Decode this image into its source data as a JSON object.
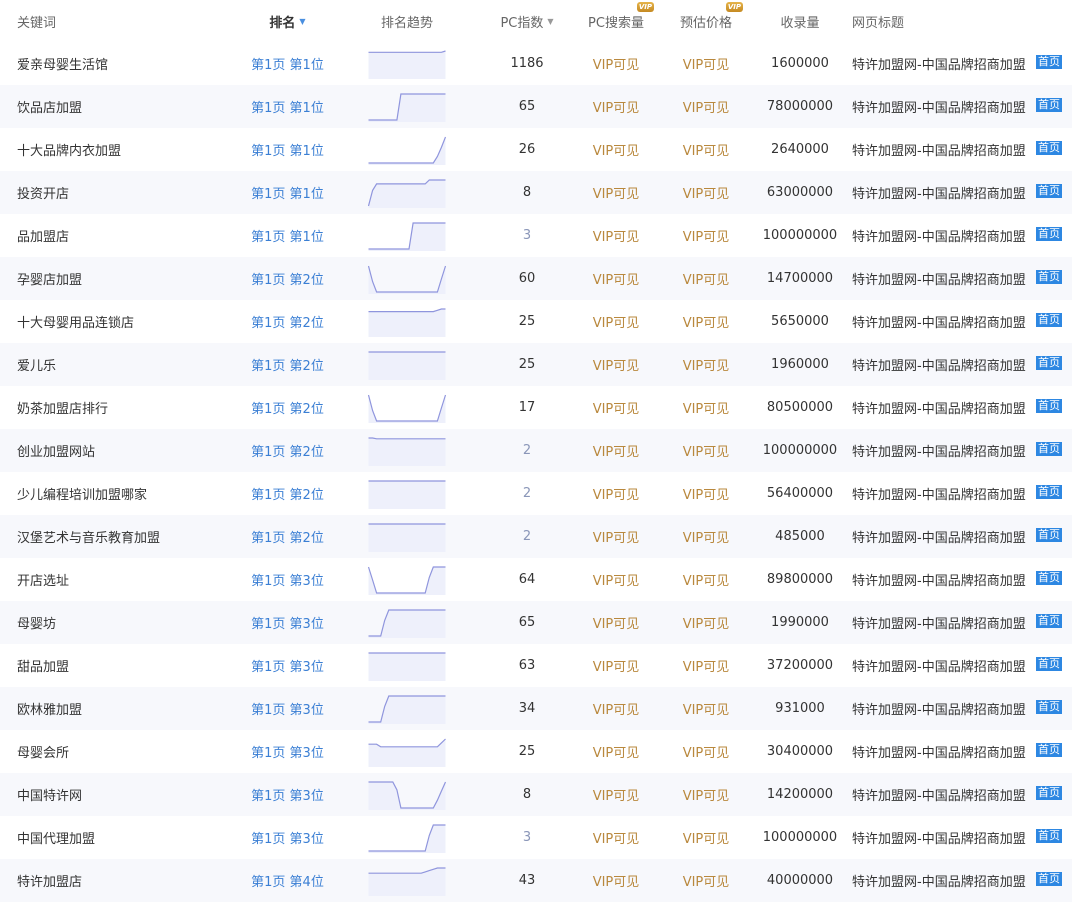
{
  "header": {
    "keyword": "关键词",
    "rank": "排名",
    "trend": "排名趋势",
    "pc_index": "PC指数",
    "pc_search": "PC搜索量",
    "est_price": "预估价格",
    "record_count": "收录量",
    "page_title": "网页标题",
    "vip_badge": "VIP",
    "sort_desc_icon": "▼"
  },
  "colors": {
    "rank_link": "#3b7fd4",
    "vip_text": "#b9883d",
    "home_tag": "#2d87e2",
    "trend_line": "#8f95dd",
    "trend_fill": "#eef0fb"
  },
  "rows": [
    {
      "keyword": "爱亲母婴生活馆",
      "rank": "第1页 第1位",
      "pc_index": "1186",
      "pc_index_light": false,
      "pc_search": "VIP可见",
      "est_price": "VIP可见",
      "record_count": "1600000",
      "page_title": "特许加盟网-中国品牌招商加盟",
      "tag": "首页",
      "trend": [
        0.05,
        0.05,
        0.05,
        0.05,
        0.05,
        0.05,
        0.05,
        0.05,
        0.05,
        0.05,
        0.05,
        0.05,
        0.05,
        0.05,
        0.05,
        0.05,
        0.05,
        0.05,
        0.05,
        0
      ]
    },
    {
      "keyword": "饮品店加盟",
      "rank": "第1页 第1位",
      "pc_index": "65",
      "pc_index_light": false,
      "pc_search": "VIP可见",
      "est_price": "VIP可见",
      "record_count": "78000000",
      "page_title": "特许加盟网-中国品牌招商加盟",
      "tag": "首页",
      "trend": [
        1,
        1,
        1,
        1,
        1,
        1,
        1,
        1,
        0,
        0,
        0,
        0,
        0,
        0,
        0,
        0,
        0,
        0,
        0,
        0
      ]
    },
    {
      "keyword": "十大品牌内衣加盟",
      "rank": "第1页 第1位",
      "pc_index": "26",
      "pc_index_light": false,
      "pc_search": "VIP可见",
      "est_price": "VIP可见",
      "record_count": "2640000",
      "page_title": "特许加盟网-中国品牌招商加盟",
      "tag": "首页",
      "trend": [
        1,
        1,
        1,
        1,
        1,
        1,
        1,
        1,
        1,
        1,
        1,
        1,
        1,
        1,
        1,
        1,
        1,
        0.75,
        0.4,
        0
      ]
    },
    {
      "keyword": "投资开店",
      "rank": "第1页 第1位",
      "pc_index": "8",
      "pc_index_light": false,
      "pc_search": "VIP可见",
      "est_price": "VIP可见",
      "record_count": "63000000",
      "page_title": "特许加盟网-中国品牌招商加盟",
      "tag": "首页",
      "trend": [
        1,
        0.4,
        0.15,
        0.15,
        0.15,
        0.15,
        0.15,
        0.15,
        0.15,
        0.15,
        0.15,
        0.15,
        0.15,
        0.15,
        0.15,
        0,
        0,
        0,
        0,
        0
      ]
    },
    {
      "keyword": "品加盟店",
      "rank": "第1页 第1位",
      "pc_index": "3",
      "pc_index_light": true,
      "pc_search": "VIP可见",
      "est_price": "VIP可见",
      "record_count": "100000000",
      "page_title": "特许加盟网-中国品牌招商加盟",
      "tag": "首页",
      "trend": [
        1,
        1,
        1,
        1,
        1,
        1,
        1,
        1,
        1,
        1,
        1,
        0,
        0,
        0,
        0,
        0,
        0,
        0,
        0,
        0
      ]
    },
    {
      "keyword": "孕婴店加盟",
      "rank": "第1页 第2位",
      "pc_index": "60",
      "pc_index_light": false,
      "pc_search": "VIP可见",
      "est_price": "VIP可见",
      "record_count": "14700000",
      "page_title": "特许加盟网-中国品牌招商加盟",
      "tag": "首页",
      "trend": [
        0,
        0.6,
        1,
        1,
        1,
        1,
        1,
        1,
        1,
        1,
        1,
        1,
        1,
        1,
        1,
        1,
        1,
        1,
        0.5,
        0
      ]
    },
    {
      "keyword": "十大母婴用品连锁店",
      "rank": "第1页 第2位",
      "pc_index": "25",
      "pc_index_light": false,
      "pc_search": "VIP可见",
      "est_price": "VIP可见",
      "record_count": "5650000",
      "page_title": "特许加盟网-中国品牌招商加盟",
      "tag": "首页",
      "trend": [
        0.1,
        0.1,
        0.1,
        0.1,
        0.1,
        0.1,
        0.1,
        0.1,
        0.1,
        0.1,
        0.1,
        0.1,
        0.1,
        0.1,
        0.1,
        0.1,
        0.1,
        0.05,
        0,
        0
      ]
    },
    {
      "keyword": "爱儿乐",
      "rank": "第1页 第2位",
      "pc_index": "25",
      "pc_index_light": false,
      "pc_search": "VIP可见",
      "est_price": "VIP可见",
      "record_count": "1960000",
      "page_title": "特许加盟网-中国品牌招商加盟",
      "tag": "首页",
      "trend": [
        0,
        0,
        0,
        0,
        0,
        0,
        0,
        0,
        0,
        0,
        0,
        0,
        0,
        0,
        0,
        0,
        0,
        0,
        0,
        0
      ]
    },
    {
      "keyword": "奶茶加盟店排行",
      "rank": "第1页 第2位",
      "pc_index": "17",
      "pc_index_light": false,
      "pc_search": "VIP可见",
      "est_price": "VIP可见",
      "record_count": "80500000",
      "page_title": "特许加盟网-中国品牌招商加盟",
      "tag": "首页",
      "trend": [
        0,
        0.6,
        1,
        1,
        1,
        1,
        1,
        1,
        1,
        1,
        1,
        1,
        1,
        1,
        1,
        1,
        1,
        1,
        0.5,
        0
      ]
    },
    {
      "keyword": "创业加盟网站",
      "rank": "第1页 第2位",
      "pc_index": "2",
      "pc_index_light": true,
      "pc_search": "VIP可见",
      "est_price": "VIP可见",
      "record_count": "100000000",
      "page_title": "特许加盟网-中国品牌招商加盟",
      "tag": "首页",
      "trend": [
        0,
        0,
        0.03,
        0.03,
        0.03,
        0.03,
        0.03,
        0.03,
        0.03,
        0.03,
        0.03,
        0.03,
        0.03,
        0.03,
        0.03,
        0.03,
        0.03,
        0.03,
        0.03,
        0.03
      ]
    },
    {
      "keyword": "少儿编程培训加盟哪家",
      "rank": "第1页 第2位",
      "pc_index": "2",
      "pc_index_light": true,
      "pc_search": "VIP可见",
      "est_price": "VIP可见",
      "record_count": "56400000",
      "page_title": "特许加盟网-中国品牌招商加盟",
      "tag": "首页",
      "trend": [
        0,
        0,
        0,
        0,
        0,
        0,
        0,
        0,
        0,
        0,
        0,
        0,
        0,
        0,
        0,
        0,
        0,
        0,
        0,
        0
      ]
    },
    {
      "keyword": "汉堡艺术与音乐教育加盟",
      "rank": "第1页 第2位",
      "pc_index": "2",
      "pc_index_light": true,
      "pc_search": "VIP可见",
      "est_price": "VIP可见",
      "record_count": "485000",
      "page_title": "特许加盟网-中国品牌招商加盟",
      "tag": "首页",
      "trend": [
        0,
        0,
        0,
        0,
        0,
        0,
        0,
        0,
        0,
        0,
        0,
        0,
        0,
        0,
        0,
        0,
        0,
        0,
        0,
        0
      ]
    },
    {
      "keyword": "开店选址",
      "rank": "第1页 第3位",
      "pc_index": "64",
      "pc_index_light": false,
      "pc_search": "VIP可见",
      "est_price": "VIP可见",
      "record_count": "89800000",
      "page_title": "特许加盟网-中国品牌招商加盟",
      "tag": "首页",
      "trend": [
        0,
        0.5,
        1,
        1,
        1,
        1,
        1,
        1,
        1,
        1,
        1,
        1,
        1,
        1,
        1,
        0.4,
        0,
        0,
        0,
        0
      ]
    },
    {
      "keyword": "母婴坊",
      "rank": "第1页 第3位",
      "pc_index": "65",
      "pc_index_light": false,
      "pc_search": "VIP可见",
      "est_price": "VIP可见",
      "record_count": "1990000",
      "page_title": "特许加盟网-中国品牌招商加盟",
      "tag": "首页",
      "trend": [
        1,
        1,
        1,
        1,
        0.4,
        0,
        0,
        0,
        0,
        0,
        0,
        0,
        0,
        0,
        0,
        0,
        0,
        0,
        0,
        0
      ]
    },
    {
      "keyword": "甜品加盟",
      "rank": "第1页 第3位",
      "pc_index": "63",
      "pc_index_light": false,
      "pc_search": "VIP可见",
      "est_price": "VIP可见",
      "record_count": "37200000",
      "page_title": "特许加盟网-中国品牌招商加盟",
      "tag": "首页",
      "trend": [
        0,
        0,
        0,
        0,
        0,
        0,
        0,
        0,
        0,
        0,
        0,
        0,
        0,
        0,
        0,
        0,
        0,
        0,
        0,
        0
      ]
    },
    {
      "keyword": "欧林雅加盟",
      "rank": "第1页 第3位",
      "pc_index": "34",
      "pc_index_light": false,
      "pc_search": "VIP可见",
      "est_price": "VIP可见",
      "record_count": "931000",
      "page_title": "特许加盟网-中国品牌招商加盟",
      "tag": "首页",
      "trend": [
        1,
        1,
        1,
        1,
        0.4,
        0,
        0,
        0,
        0,
        0,
        0,
        0,
        0,
        0,
        0,
        0,
        0,
        0,
        0,
        0
      ]
    },
    {
      "keyword": "母婴会所",
      "rank": "第1页 第3位",
      "pc_index": "25",
      "pc_index_light": false,
      "pc_search": "VIP可见",
      "est_price": "VIP可见",
      "record_count": "30400000",
      "page_title": "特许加盟网-中国品牌招商加盟",
      "tag": "首页",
      "trend": [
        0.2,
        0.2,
        0.2,
        0.3,
        0.3,
        0.3,
        0.3,
        0.3,
        0.3,
        0.3,
        0.3,
        0.3,
        0.3,
        0.3,
        0.3,
        0.3,
        0.3,
        0.3,
        0.15,
        0
      ]
    },
    {
      "keyword": "中国特许网",
      "rank": "第1页 第3位",
      "pc_index": "8",
      "pc_index_light": false,
      "pc_search": "VIP可见",
      "est_price": "VIP可见",
      "record_count": "14200000",
      "page_title": "特许加盟网-中国品牌招商加盟",
      "tag": "首页",
      "trend": [
        0,
        0,
        0,
        0,
        0,
        0,
        0,
        0.3,
        1,
        1,
        1,
        1,
        1,
        1,
        1,
        1,
        1,
        0.7,
        0.35,
        0
      ]
    },
    {
      "keyword": "中国代理加盟",
      "rank": "第1页 第3位",
      "pc_index": "3",
      "pc_index_light": true,
      "pc_search": "VIP可见",
      "est_price": "VIP可见",
      "record_count": "100000000",
      "page_title": "特许加盟网-中国品牌招商加盟",
      "tag": "首页",
      "trend": [
        1,
        1,
        1,
        1,
        1,
        1,
        1,
        1,
        1,
        1,
        1,
        1,
        1,
        1,
        1,
        0.4,
        0,
        0,
        0,
        0
      ]
    },
    {
      "keyword": "特许加盟店",
      "rank": "第1页 第4位",
      "pc_index": "43",
      "pc_index_light": false,
      "pc_search": "VIP可见",
      "est_price": "VIP可见",
      "record_count": "40000000",
      "page_title": "特许加盟网-中国品牌招商加盟",
      "tag": "首页",
      "trend": [
        0.2,
        0.2,
        0.2,
        0.2,
        0.2,
        0.2,
        0.2,
        0.2,
        0.2,
        0.2,
        0.2,
        0.2,
        0.2,
        0.2,
        0.15,
        0.1,
        0.05,
        0,
        0,
        0
      ]
    }
  ]
}
